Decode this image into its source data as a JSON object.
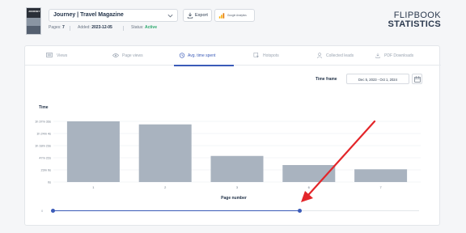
{
  "header": {
    "cover_text": "JOURNEY",
    "publication_title": "Journey | Travel Magazine",
    "export_label": "Export",
    "ga_label": "Google Analytics",
    "pages_label": "Pages:",
    "pages_value": "7",
    "added_label": "Added:",
    "added_value": "2023-12-05",
    "status_label": "Status:",
    "status_value": "Active",
    "brand_line1": "FLIPBOOK",
    "brand_line2": "STATISTICS"
  },
  "tabs": [
    {
      "label": "Views",
      "icon": "screen-icon",
      "active": false
    },
    {
      "label": "Page views",
      "icon": "eye-icon",
      "active": false
    },
    {
      "label": "Avg. time spent",
      "icon": "clock-icon",
      "active": true
    },
    {
      "label": "Hotspots",
      "icon": "cursor-icon",
      "active": false
    },
    {
      "label": "Collected leads",
      "icon": "user-icon",
      "active": false
    },
    {
      "label": "PDF Downloads",
      "icon": "download-icon",
      "active": false
    }
  ],
  "time_frame": {
    "label": "Time frame",
    "value": "Dec 5, 2023 - Oct 1, 2024"
  },
  "chart_data": {
    "type": "bar",
    "ylabel": "Time",
    "xlabel": "Page number",
    "categories": [
      "1",
      "2",
      "3",
      "6",
      "7"
    ],
    "values": [
      1.0,
      0.95,
      0.43,
      0.28,
      0.21
    ],
    "yticks": [
      "1h 37m 33s",
      "1h 24m 4s",
      "1h 18m 23s",
      "47m 22s",
      "23m 9s",
      "0s"
    ],
    "bar_color": "#a9b3bf",
    "grid": true
  },
  "range_slider": {
    "min_label": "0",
    "start": 0.0,
    "end": 0.67
  },
  "colors": {
    "accent": "#3b5bb8",
    "active_status": "#2aa86b",
    "annotation_arrow": "#e3262a"
  }
}
